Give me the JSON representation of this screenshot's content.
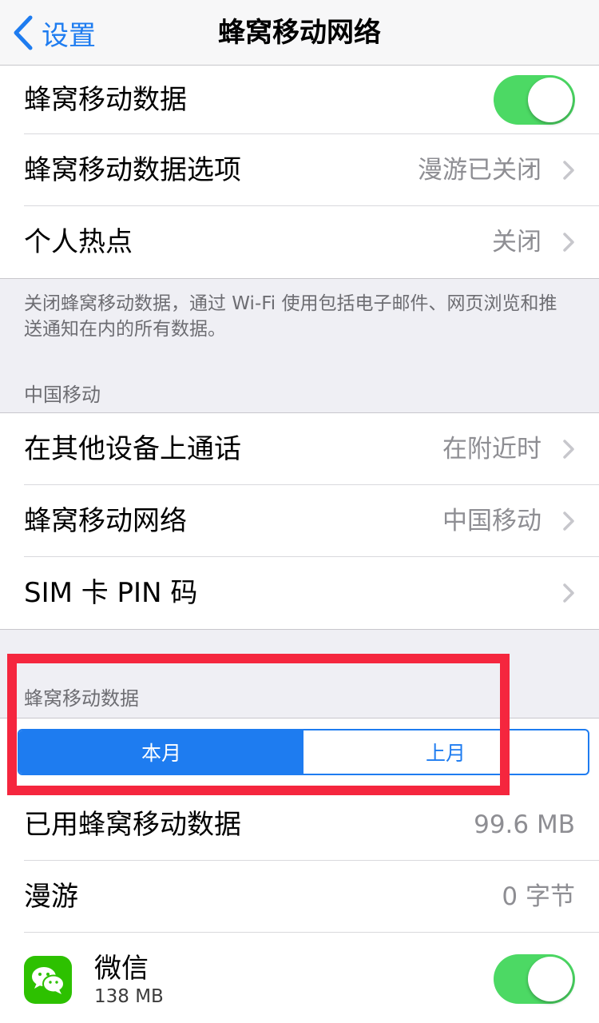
{
  "nav": {
    "back_label": "设置",
    "title": "蜂窝移动网络"
  },
  "group1": {
    "cellular_data": {
      "label": "蜂窝移动数据",
      "enabled": true
    },
    "cellular_options": {
      "label": "蜂窝移动数据选项",
      "value": "漫游已关闭"
    },
    "hotspot": {
      "label": "个人热点",
      "value": "关闭"
    }
  },
  "group1_footer": "关闭蜂窝移动数据，通过 Wi-Fi 使用包括电子邮件、网页浏览和推送通知在内的所有数据。",
  "carrier_header": "中国移动",
  "group2": {
    "calls_other_devices": {
      "label": "在其他设备上通话",
      "value": "在附近时"
    },
    "network": {
      "label": "蜂窝移动网络",
      "value": "中国移动"
    },
    "sim_pin": {
      "label": "SIM 卡 PIN 码"
    }
  },
  "usage_header": "蜂窝移动数据",
  "segments": {
    "this_month": "本月",
    "last_month": "上月",
    "selected": "本月"
  },
  "usage": {
    "used": {
      "label": "已用蜂窝移动数据",
      "value": "99.6 MB"
    },
    "roaming": {
      "label": "漫游",
      "value": "0 字节"
    }
  },
  "apps": [
    {
      "name": "微信",
      "size": "138 MB",
      "enabled": true,
      "icon": "wechat-icon"
    }
  ],
  "colors": {
    "accent": "#1e7cf0",
    "switch_on": "#4cd964",
    "highlight": "#f5263e",
    "wechat": "#2dc100"
  }
}
